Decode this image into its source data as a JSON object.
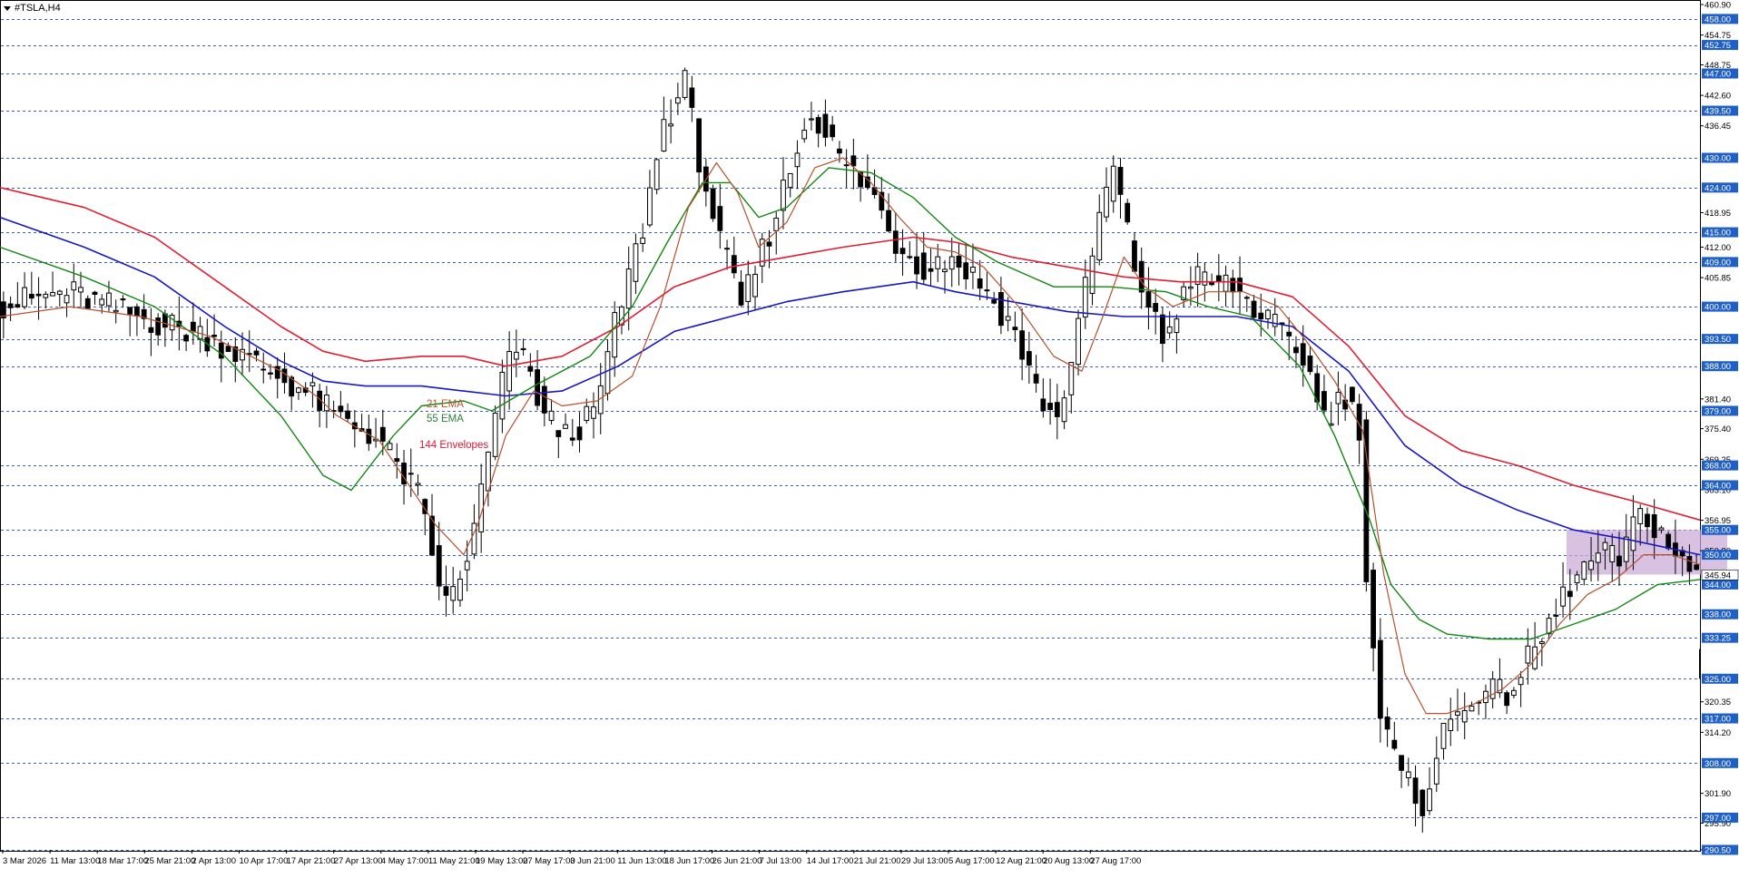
{
  "symbol": "#TSLA,H4",
  "chart_data": {
    "type": "candlestick",
    "y_axis_ticks": [
      "460.90",
      "454.75",
      "448.75",
      "442.60",
      "436.45",
      "418.95",
      "412.00",
      "405.85",
      "381.40",
      "375.40",
      "369.25",
      "363.10",
      "356.95",
      "350.80",
      "320.35",
      "314.20",
      "301.90",
      "295.90",
      "290.50"
    ],
    "ylim": [
      290.5,
      460.9
    ],
    "levels": [
      "458.00",
      "452.75",
      "447.00",
      "439.50",
      "430.00",
      "424.00",
      "415.00",
      "409.00",
      "400.00",
      "393.50",
      "388.00",
      "379.00",
      "368.00",
      "364.00",
      "355.00",
      "350.00",
      "344.00",
      "338.00",
      "333.25",
      "325.00",
      "317.00",
      "308.00",
      "297.00",
      "290.50"
    ],
    "current_price": "345.94",
    "x_labels": [
      "3 Mar 2026",
      "11 Mar 13:00",
      "18 Mar 17:00",
      "25 Mar 21:00",
      "2 Apr 13:00",
      "10 Apr 17:00",
      "17 Apr 21:00",
      "27 Apr 13:00",
      "4 May 17:00",
      "11 May 21:00",
      "19 May 13:00",
      "27 May 17:00",
      "3 Jun 21:00",
      "11 Jun 13:00",
      "18 Jun 17:00",
      "26 Jun 21:00",
      "7 Jul 13:00",
      "14 Jul 17:00",
      "21 Jul 21:00",
      "29 Jul 13:00",
      "5 Aug 17:00",
      "12 Aug 21:00",
      "20 Aug 13:00",
      "27 Aug 17:00"
    ],
    "close_path": [
      [
        0,
        400
      ],
      [
        10,
        403
      ],
      [
        20,
        398
      ],
      [
        30,
        394
      ],
      [
        40,
        386
      ],
      [
        45,
        382
      ],
      [
        48,
        378
      ],
      [
        54,
        374
      ],
      [
        60,
        362
      ],
      [
        62,
        350
      ],
      [
        64,
        340
      ],
      [
        66,
        345
      ],
      [
        68,
        355
      ],
      [
        70,
        370
      ],
      [
        72,
        385
      ],
      [
        74,
        392
      ],
      [
        76,
        386
      ],
      [
        78,
        378
      ],
      [
        81,
        374
      ],
      [
        85,
        378
      ],
      [
        88,
        396
      ],
      [
        92,
        416
      ],
      [
        95,
        437
      ],
      [
        98,
        445
      ],
      [
        100,
        430
      ],
      [
        103,
        413
      ],
      [
        106,
        400
      ],
      [
        110,
        415
      ],
      [
        114,
        432
      ],
      [
        116,
        440
      ],
      [
        120,
        430
      ],
      [
        125,
        422
      ],
      [
        128,
        413
      ],
      [
        132,
        408
      ],
      [
        136,
        410
      ],
      [
        140,
        405
      ],
      [
        145,
        395
      ],
      [
        148,
        383
      ],
      [
        151,
        377
      ],
      [
        154,
        396
      ],
      [
        157,
        418
      ],
      [
        159,
        428
      ],
      [
        162,
        408
      ],
      [
        166,
        393
      ],
      [
        170,
        406
      ],
      [
        176,
        404
      ],
      [
        181,
        397
      ],
      [
        186,
        390
      ],
      [
        189,
        378
      ],
      [
        192,
        382
      ],
      [
        194,
        376
      ],
      [
        195,
        346
      ],
      [
        197,
        317
      ],
      [
        200,
        305
      ],
      [
        203,
        300
      ],
      [
        206,
        314
      ],
      [
        210,
        322
      ],
      [
        215,
        322
      ],
      [
        220,
        333
      ],
      [
        224,
        344
      ],
      [
        228,
        350
      ],
      [
        231,
        349
      ],
      [
        234,
        358
      ],
      [
        237,
        355
      ],
      [
        239,
        349
      ],
      [
        242,
        346
      ]
    ],
    "ema21_path": [
      [
        0,
        398
      ],
      [
        10,
        400
      ],
      [
        20,
        398
      ],
      [
        30,
        394
      ],
      [
        40,
        387
      ],
      [
        45,
        382
      ],
      [
        48,
        378
      ],
      [
        54,
        373
      ],
      [
        62,
        356
      ],
      [
        66,
        350
      ],
      [
        68,
        356
      ],
      [
        72,
        374
      ],
      [
        76,
        383
      ],
      [
        80,
        380
      ],
      [
        85,
        381
      ],
      [
        90,
        386
      ],
      [
        94,
        400
      ],
      [
        98,
        420
      ],
      [
        102,
        429
      ],
      [
        105,
        423
      ],
      [
        108,
        412
      ],
      [
        112,
        417
      ],
      [
        116,
        428
      ],
      [
        120,
        430
      ],
      [
        124,
        425
      ],
      [
        128,
        418
      ],
      [
        132,
        412
      ],
      [
        136,
        411
      ],
      [
        140,
        408
      ],
      [
        145,
        400
      ],
      [
        150,
        390
      ],
      [
        154,
        387
      ],
      [
        157,
        398
      ],
      [
        160,
        410
      ],
      [
        163,
        404
      ],
      [
        167,
        400
      ],
      [
        172,
        403
      ],
      [
        177,
        403
      ],
      [
        182,
        400
      ],
      [
        186,
        393
      ],
      [
        190,
        385
      ],
      [
        194,
        375
      ],
      [
        197,
        346
      ],
      [
        200,
        326
      ],
      [
        203,
        318
      ],
      [
        206,
        318
      ],
      [
        210,
        320
      ],
      [
        214,
        323
      ],
      [
        218,
        328
      ],
      [
        222,
        336
      ],
      [
        226,
        342
      ],
      [
        230,
        345
      ],
      [
        234,
        350
      ],
      [
        238,
        350
      ],
      [
        242,
        348
      ]
    ],
    "ema55_path": [
      [
        0,
        412
      ],
      [
        12,
        406
      ],
      [
        22,
        400
      ],
      [
        32,
        390
      ],
      [
        40,
        378
      ],
      [
        46,
        366
      ],
      [
        50,
        363
      ],
      [
        56,
        374
      ],
      [
        60,
        380
      ],
      [
        66,
        381
      ],
      [
        70,
        379
      ],
      [
        76,
        384
      ],
      [
        84,
        390
      ],
      [
        90,
        400
      ],
      [
        95,
        413
      ],
      [
        100,
        425
      ],
      [
        104,
        425
      ],
      [
        108,
        418
      ],
      [
        112,
        420
      ],
      [
        118,
        428
      ],
      [
        124,
        427
      ],
      [
        130,
        422
      ],
      [
        136,
        414
      ],
      [
        142,
        409
      ],
      [
        150,
        404
      ],
      [
        158,
        404
      ],
      [
        166,
        403
      ],
      [
        172,
        400
      ],
      [
        178,
        398
      ],
      [
        185,
        388
      ],
      [
        190,
        374
      ],
      [
        195,
        357
      ],
      [
        198,
        344
      ],
      [
        202,
        337
      ],
      [
        206,
        334
      ],
      [
        212,
        333
      ],
      [
        218,
        333
      ],
      [
        224,
        336
      ],
      [
        230,
        339
      ],
      [
        236,
        344
      ],
      [
        242,
        345
      ]
    ],
    "env_upper_path": [
      [
        0,
        424
      ],
      [
        12,
        420
      ],
      [
        22,
        414
      ],
      [
        32,
        404
      ],
      [
        40,
        396
      ],
      [
        46,
        391
      ],
      [
        52,
        389
      ],
      [
        60,
        390
      ],
      [
        66,
        390
      ],
      [
        72,
        388
      ],
      [
        80,
        390
      ],
      [
        88,
        396
      ],
      [
        96,
        404
      ],
      [
        104,
        408
      ],
      [
        112,
        410
      ],
      [
        120,
        412
      ],
      [
        130,
        414
      ],
      [
        136,
        413
      ],
      [
        144,
        410
      ],
      [
        152,
        408
      ],
      [
        160,
        406
      ],
      [
        168,
        405
      ],
      [
        176,
        405
      ],
      [
        184,
        402
      ],
      [
        192,
        392
      ],
      [
        200,
        378
      ],
      [
        208,
        371
      ],
      [
        216,
        368
      ],
      [
        224,
        364
      ],
      [
        232,
        361
      ],
      [
        242,
        357
      ]
    ],
    "env_mid_path": [
      [
        0,
        418
      ],
      [
        12,
        412
      ],
      [
        22,
        406
      ],
      [
        32,
        396
      ],
      [
        40,
        389
      ],
      [
        46,
        385
      ],
      [
        52,
        384
      ],
      [
        60,
        384
      ],
      [
        66,
        383
      ],
      [
        72,
        382
      ],
      [
        80,
        383
      ],
      [
        88,
        388
      ],
      [
        96,
        395
      ],
      [
        104,
        398
      ],
      [
        112,
        401
      ],
      [
        120,
        403
      ],
      [
        130,
        405
      ],
      [
        136,
        403
      ],
      [
        144,
        401
      ],
      [
        152,
        399
      ],
      [
        160,
        398
      ],
      [
        168,
        398
      ],
      [
        176,
        398
      ],
      [
        184,
        396
      ],
      [
        192,
        387
      ],
      [
        200,
        372
      ],
      [
        208,
        364
      ],
      [
        216,
        359
      ],
      [
        224,
        355
      ],
      [
        232,
        353
      ],
      [
        242,
        350
      ]
    ],
    "envelope_box": {
      "from": 223,
      "to": 242,
      "low": 346,
      "high": 355
    },
    "legend": [
      {
        "name": "21 EMA",
        "color": "#b5522e"
      },
      {
        "name": "55 EMA",
        "color": "#2e7f3c"
      },
      {
        "name": "144 Envelopes",
        "color": "#d9163c"
      }
    ],
    "grid": "dashed",
    "colors": {
      "ema21": "#b5522e",
      "ema55": "#118811",
      "env_upper": "#e01e34",
      "env_mid": "#1717c4",
      "candles": "#000000",
      "price_tag": "#1f5fc8",
      "box": "#c9a7d6"
    }
  }
}
